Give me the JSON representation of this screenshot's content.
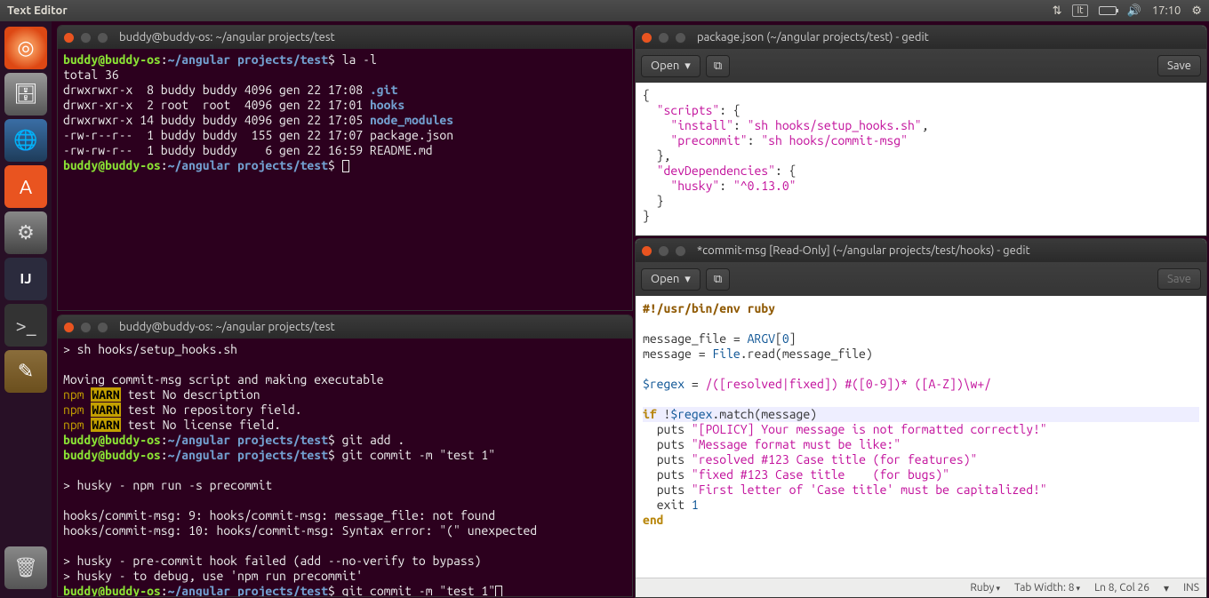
{
  "topbar": {
    "app_title": "Text Editor",
    "lang": "It",
    "time": "17:10"
  },
  "launcher": {
    "dash": "⚙",
    "files": "🗄",
    "firefox": "🦊",
    "software": "A",
    "settings": "⚙",
    "intellij": "IJ",
    "terminal": ">_",
    "gedit": "✎",
    "trash": "🗑"
  },
  "term1": {
    "title": "buddy@buddy-os: ~/angular projects/test",
    "prompt_user": "buddy@buddy-os",
    "prompt_path": "~/angular projects/test",
    "cmd1": "la -l",
    "total": "total 36",
    "lines": [
      {
        "perm": "drwxrwxr-x  8 buddy buddy 4096 gen 22 17:08 ",
        "name": ".git",
        "dir": true
      },
      {
        "perm": "drwxr-xr-x  2 root  root  4096 gen 22 17:01 ",
        "name": "hooks",
        "dir": true
      },
      {
        "perm": "drwxrwxr-x 14 buddy buddy 4096 gen 22 17:05 ",
        "name": "node_modules",
        "dir": true
      },
      {
        "perm": "-rw-r--r--  1 buddy buddy  155 gen 22 17:07 ",
        "name": "package.json",
        "dir": false
      },
      {
        "perm": "-rw-rw-r--  1 buddy buddy    6 gen 22 16:59 ",
        "name": "README.md",
        "dir": false
      }
    ]
  },
  "term2": {
    "title": "buddy@buddy-os: ~/angular projects/test",
    "l1": "> sh hooks/setup_hooks.sh",
    "l2": "Moving commit-msg script and making executable",
    "warn": "WARN",
    "npm": "npm",
    "w1": " test No description",
    "w2": " test No repository field.",
    "w3": " test No license field.",
    "cmd_add": "git add .",
    "cmd_commit": "git commit -m \"test 1\"",
    "husky1": "> husky - npm run -s precommit",
    "err1": "hooks/commit-msg: 9: hooks/commit-msg: message_file: not found",
    "err2": "hooks/commit-msg: 10: hooks/commit-msg: Syntax error: \"(\" unexpected",
    "husky2": "> husky - pre-commit hook failed (add --no-verify to bypass)",
    "husky3": "> husky - to debug, use 'npm run precommit'"
  },
  "gedit1": {
    "title": "package.json (~/angular projects/test) - gedit",
    "open": "Open",
    "save": "Save",
    "json": {
      "k_scripts": "\"scripts\"",
      "k_install": "\"install\"",
      "v_install": "\"sh hooks/setup_hooks.sh\"",
      "k_precommit": "\"precommit\"",
      "v_precommit": "\"sh hooks/commit-msg\"",
      "k_devdep": "\"devDependencies\"",
      "k_husky": "\"husky\"",
      "v_husky": "\"^0.13.0\""
    }
  },
  "gedit2": {
    "title": "*commit-msg [Read-Only] (~/angular projects/test/hooks) - gedit",
    "open": "Open",
    "save": "Save",
    "shebang": "#!/usr/bin/env ruby",
    "l_msgfile": "message_file = ",
    "argv": "ARGV",
    "idx": "0",
    "l_msg_a": "message = ",
    "file_const": "File",
    "read_call": ".read(message_file)",
    "regex_lhs": "$regex",
    "eq": " = ",
    "regex": "/([resolved|fixed]) #([0-9])* ([A-Z])\\w+/",
    "if": "if",
    "not": "!",
    "match": ".match(message)",
    "puts": "puts",
    "s1": "\"[POLICY] Your message is not formatted correctly!\"",
    "s2": "\"Message format must be like:\"",
    "s3": "\"resolved #123 Case title (for features)\"",
    "s4": "\"fixed #123 Case title    (for bugs)\"",
    "s5": "\"First letter of 'Case title' must be capitalized!\"",
    "exit": "exit",
    "one": "1",
    "end": "end"
  },
  "statusbar": {
    "lang": "Ruby",
    "tabwidth": "Tab Width: 8",
    "pos": "Ln 8, Col 26",
    "ins": "INS"
  }
}
